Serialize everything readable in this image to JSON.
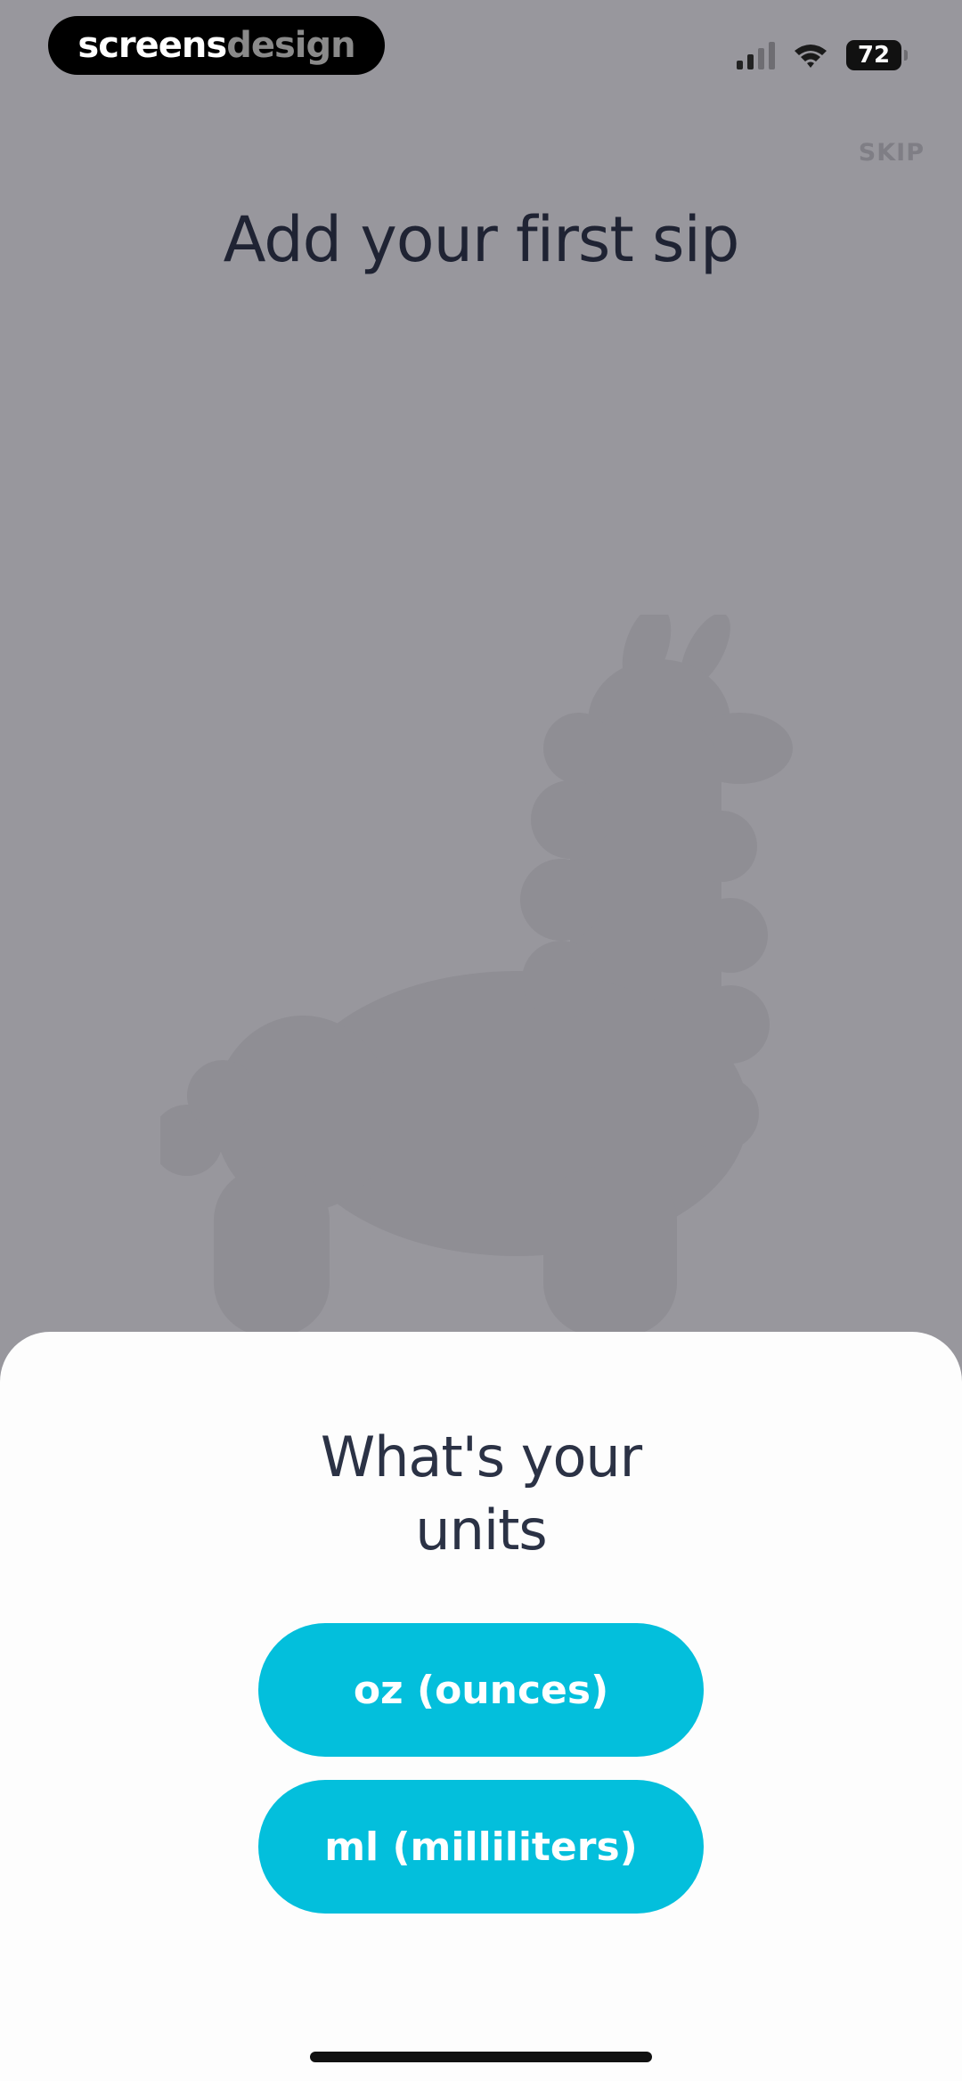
{
  "watermark": {
    "part1": "screens",
    "part2": "design"
  },
  "status_bar": {
    "battery": "72",
    "icons": [
      "signal-icon",
      "wifi-icon",
      "battery-icon"
    ]
  },
  "header": {
    "skip_label": "SKIP",
    "title": "Add your first sip"
  },
  "illustration": {
    "icon": "llama-silhouette"
  },
  "sheet": {
    "title_line1": "What's your",
    "title_line2": "units",
    "options": [
      {
        "label": "oz (ounces)"
      },
      {
        "label": "ml (milliliters)"
      }
    ]
  },
  "colors": {
    "overlay_bg": "#98979d",
    "sheet_bg": "#fdfdfd",
    "accent": "#03bfdc",
    "title_text": "#1f2333"
  }
}
